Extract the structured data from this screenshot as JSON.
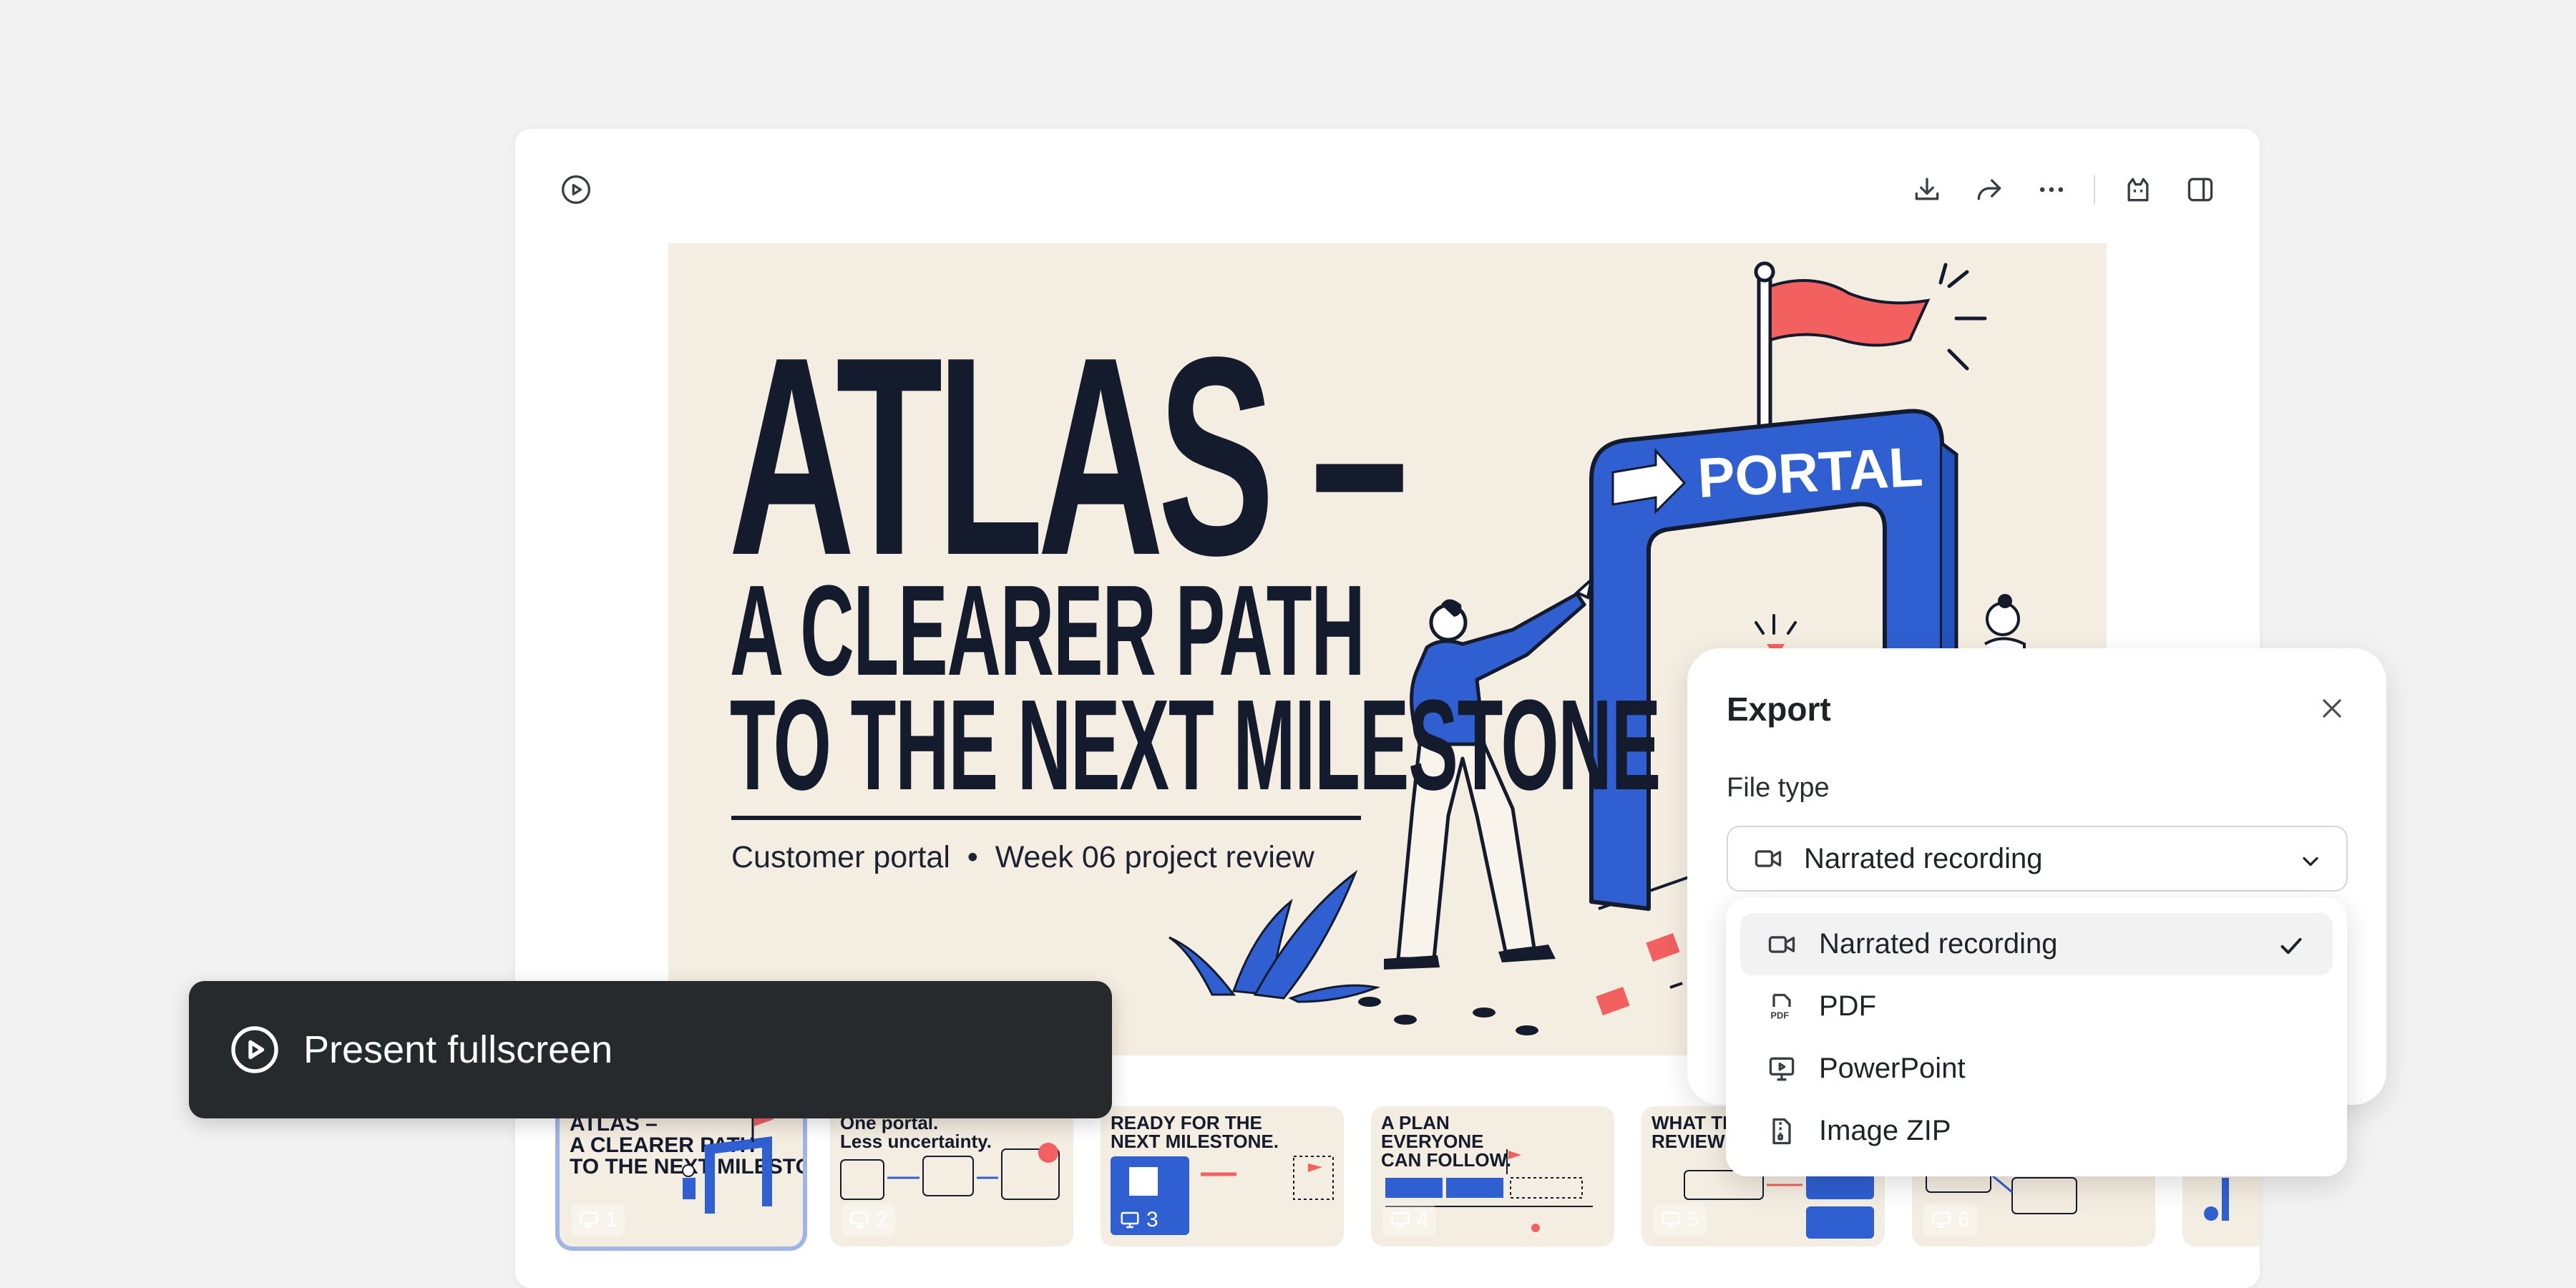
{
  "toolbar": {
    "play_icon": "play-circle-icon",
    "right_icons": [
      "download-icon",
      "share-icon",
      "more-icon",
      "assistant-icon",
      "sidebar-toggle-icon"
    ]
  },
  "slide": {
    "title_line_1": "ATLAS –",
    "title_line_2": "A CLEARER PATH",
    "title_line_3": "TO THE NEXT MILESTONE",
    "subtitle": "Customer portal  •  Week 06 project review",
    "sign_text": "PORTAL",
    "colors": {
      "background": "#f4ede1",
      "ink": "#141b2d",
      "accent_blue": "#2f5fd0",
      "accent_red": "#f26060"
    }
  },
  "thumbnails": [
    {
      "title": "ATLAS –\nA CLEARER PATH\nTO THE NEXT MILESTONE",
      "number": "1",
      "selected": true
    },
    {
      "title": "One portal.\nLess uncertainty.",
      "number": "2",
      "selected": false
    },
    {
      "title": "READY FOR THE\nNEXT MILESTONE.",
      "number": "3",
      "selected": false
    },
    {
      "title": "A PLAN\nEVERYONE\nCAN FOLLOW.",
      "number": "4",
      "selected": false
    },
    {
      "title": "WHAT THE\nREVIEW TEL",
      "number": "5",
      "selected": false
    },
    {
      "title": "",
      "number": "6",
      "selected": false
    }
  ],
  "present": {
    "label": "Present fullscreen",
    "icon": "play-circle-icon"
  },
  "export": {
    "title": "Export",
    "file_type_label": "File type",
    "selected_value": "Narrated recording",
    "options": [
      {
        "label": "Narrated recording",
        "icon": "video-camera-icon",
        "selected": true
      },
      {
        "label": "PDF",
        "icon": "pdf-file-icon",
        "selected": false
      },
      {
        "label": "PowerPoint",
        "icon": "presentation-icon",
        "selected": false
      },
      {
        "label": "Image ZIP",
        "icon": "zip-file-icon",
        "selected": false
      }
    ]
  }
}
